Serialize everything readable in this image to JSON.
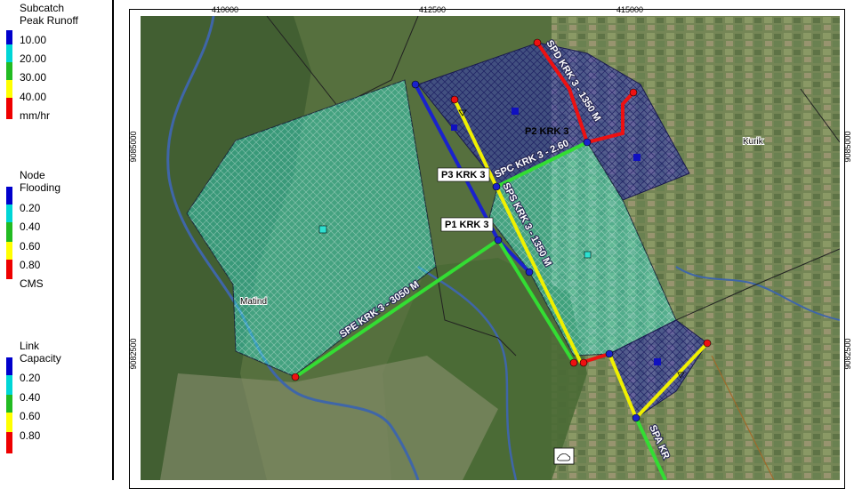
{
  "legend": {
    "subcatch": {
      "title": [
        "Subcatch",
        "Peak Runoff"
      ],
      "ticks": [
        "10.00",
        "20.00",
        "30.00",
        "40.00",
        "mm/hr"
      ],
      "colors": [
        "#0000cc",
        "#00d6d6",
        "#22bb22",
        "#ffff00",
        "#ee0000"
      ]
    },
    "node": {
      "title": [
        "Node",
        "Flooding"
      ],
      "ticks": [
        "0.20",
        "0.40",
        "0.60",
        "0.80",
        "CMS"
      ],
      "colors": [
        "#0000cc",
        "#00d6d6",
        "#22bb22",
        "#ffff00",
        "#ee0000"
      ]
    },
    "link": {
      "title": [
        "Link",
        "Capacity"
      ],
      "ticks": [
        "0.20",
        "0.40",
        "0.60",
        "0.80"
      ],
      "colors": [
        "#0000cc",
        "#00d6d6",
        "#22bb22",
        "#ffff00",
        "#ee0000"
      ]
    }
  },
  "map": {
    "x_coords": [
      "410000",
      "412500",
      "415000"
    ],
    "y_coords": [
      "9085000",
      "9082500"
    ],
    "places": [
      "Kurik",
      "Matind"
    ],
    "tags": [
      "P3 KRK 3",
      "P1 KRK 3",
      "P2 KRK 3"
    ],
    "pipes": [
      "SPE KRK 3 - 3050 M",
      "SPS KRK 3 - 1350 M",
      "SPC KRK 3 - 2.60",
      "SPD KRK 3 - 1350 M",
      "SPA KR"
    ]
  }
}
